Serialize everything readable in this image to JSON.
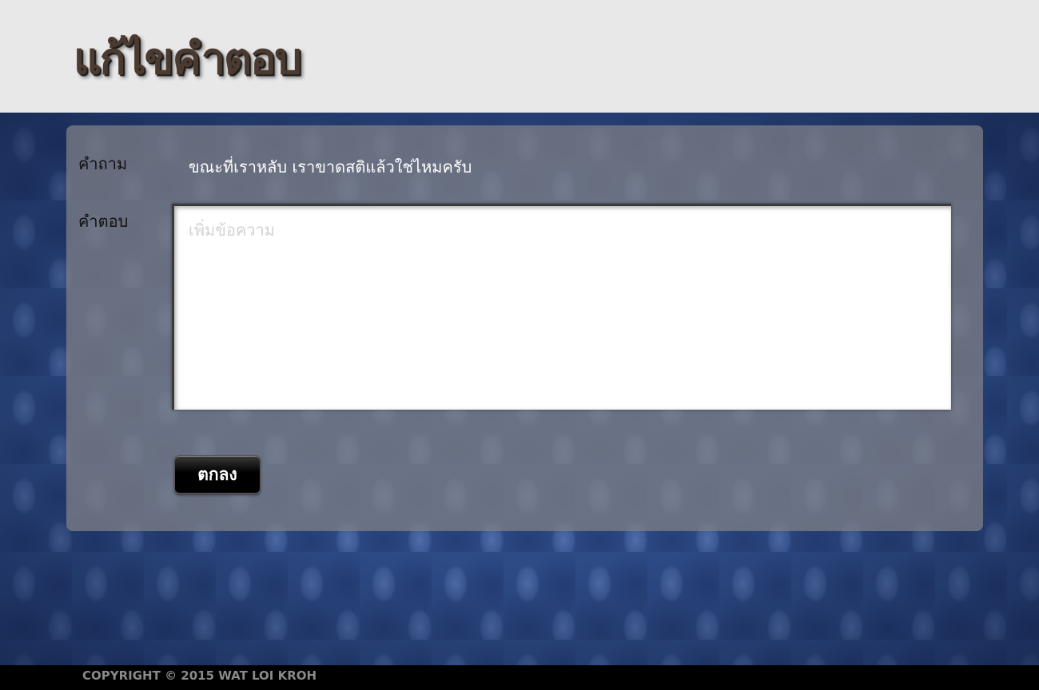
{
  "header": {
    "title": "แก้ไขคำตอบ"
  },
  "form": {
    "question_label": "คำถาม",
    "question_text": "ขณะที่เราหลับ เราขาดสติแล้วใช่ไหมครับ",
    "answer_label": "คำตอบ",
    "answer_value": "",
    "answer_placeholder": "เพิ่มข้อความ",
    "submit_label": "ตกลง"
  },
  "footer": {
    "copyright": "COPYRIGHT © 2015 WAT LOI KROH"
  },
  "colors": {
    "header_bg": "#e8e8e8",
    "background_pattern": "#2e4b86",
    "panel": "#82828b",
    "button": "#000000",
    "footer_bg": "#000000"
  }
}
